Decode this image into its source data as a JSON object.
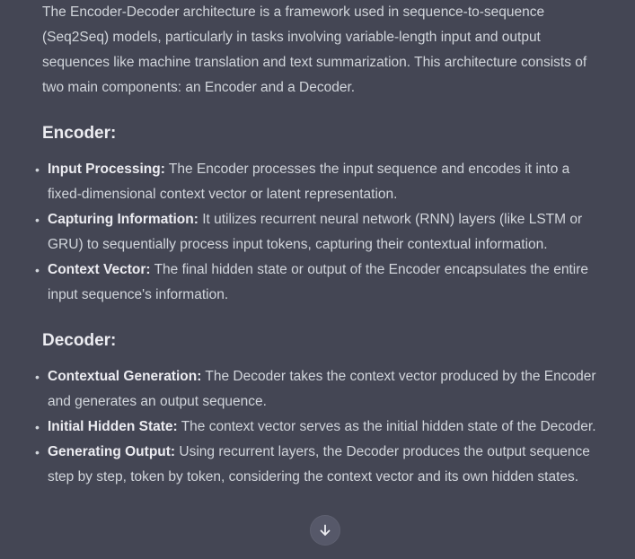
{
  "intro": "The Encoder-Decoder architecture is a framework used in sequence-to-sequence (Seq2Seq) models, particularly in tasks involving variable-length input and output sequences like machine translation and text summarization. This architecture consists of two main components: an Encoder and a Decoder.",
  "encoder": {
    "heading": "Encoder:",
    "items": [
      {
        "term": "Input Processing:",
        "text": " The Encoder processes the input sequence and encodes it into a fixed-dimensional context vector or latent representation."
      },
      {
        "term": "Capturing Information:",
        "text": " It utilizes recurrent neural network (RNN) layers (like LSTM or GRU) to sequentially process input tokens, capturing their contextual information."
      },
      {
        "term": "Context Vector:",
        "text": " The final hidden state or output of the Encoder encapsulates the entire input sequence's information."
      }
    ]
  },
  "decoder": {
    "heading": "Decoder:",
    "items": [
      {
        "term": "Contextual Generation:",
        "text": " The Decoder takes the context vector produced by the Encoder and generates an output sequence."
      },
      {
        "term": "Initial Hidden State:",
        "text": " The context vector serves as the initial hidden state of the Decoder."
      },
      {
        "term": "Generating Output:",
        "text": " Using recurrent layers, the Decoder produces the output sequence step by step, token by token, considering the context vector and its own hidden states."
      }
    ]
  },
  "scroll_button": {
    "icon": "arrow-down-icon"
  }
}
